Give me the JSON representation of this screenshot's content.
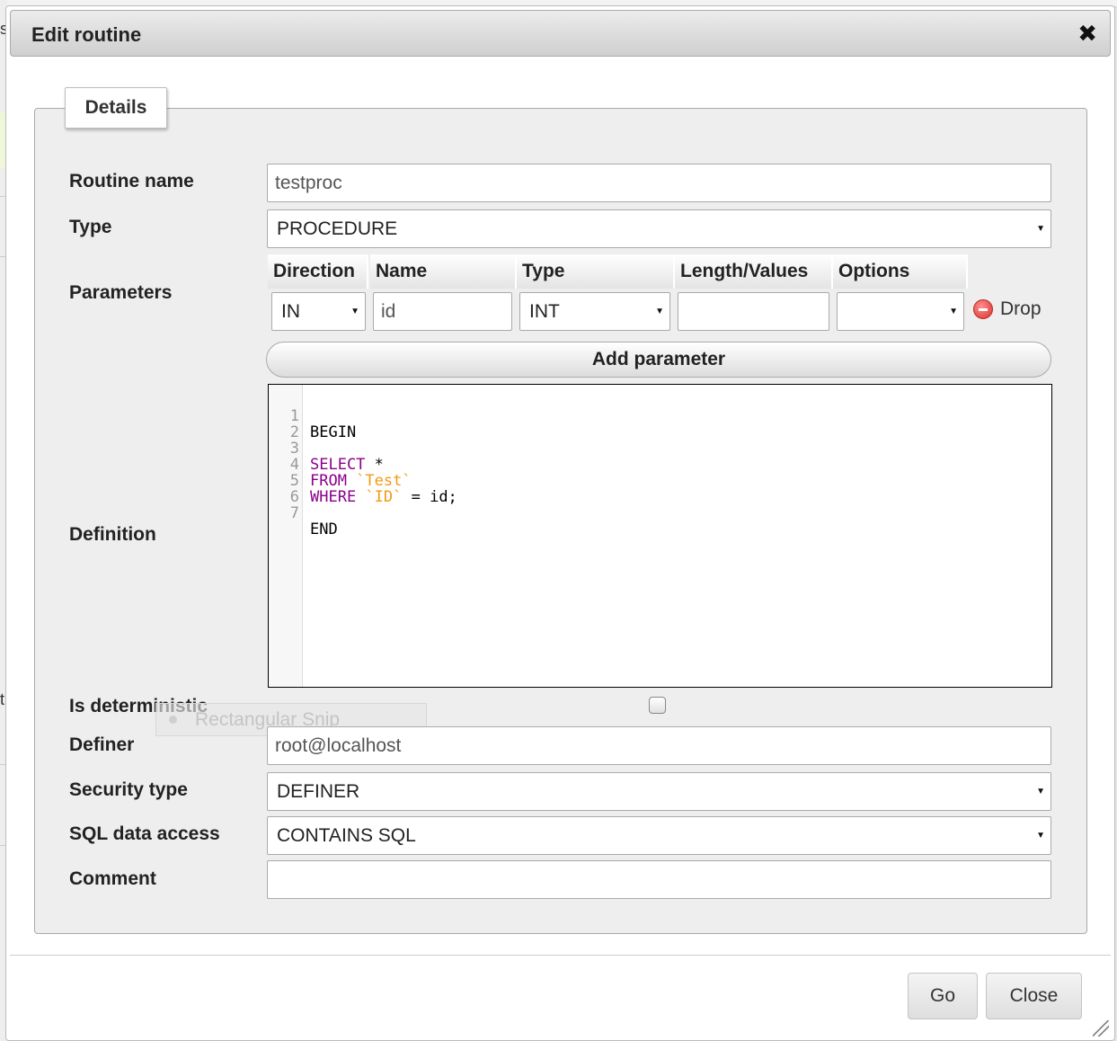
{
  "dialog": {
    "title": "Edit routine",
    "close_icon": "✖"
  },
  "tab": {
    "label": "Details"
  },
  "labels": {
    "routine_name": "Routine name",
    "type": "Type",
    "parameters": "Parameters",
    "definition": "Definition",
    "is_deterministic": "Is deterministic",
    "definer": "Definer",
    "security_type": "Security type",
    "sql_data_access": "SQL data access",
    "comment": "Comment"
  },
  "fields": {
    "routine_name": "testproc",
    "type": "PROCEDURE",
    "definer": "root@localhost",
    "security_type": "DEFINER",
    "sql_data_access": "CONTAINS SQL",
    "comment": "",
    "is_deterministic": false
  },
  "params_table": {
    "headers": [
      "Direction",
      "Name",
      "Type",
      "Length/Values",
      "Options"
    ],
    "row": {
      "direction": "IN",
      "name": "id",
      "type": "INT",
      "length": "",
      "options": ""
    },
    "drop_label": "Drop",
    "add_label": "Add parameter"
  },
  "editor": {
    "line_numbers": [
      "1",
      "2",
      "3",
      "4",
      "5",
      "6",
      "7"
    ],
    "tokens": {
      "begin": "BEGIN",
      "select": "SELECT",
      "star": " *",
      "from": "FROM",
      "test": " `Test`",
      "where": "WHERE",
      "id_col": " `ID`",
      "eq": " = id;",
      "end": "END"
    }
  },
  "overlay": {
    "snip_label": "Rectangular Snip"
  },
  "footer": {
    "go_label": "Go",
    "close_label": "Close"
  },
  "background": {
    "char_1": "s",
    "char_2": "t"
  },
  "colors": {
    "keyword": "#8b008b",
    "string": "#f29a12",
    "drop_icon": "#d9312c"
  },
  "icons": {
    "drop": "minus-circle-icon",
    "close": "close-icon",
    "caret": "caret-down-icon",
    "resize": "resize-grip-icon"
  }
}
